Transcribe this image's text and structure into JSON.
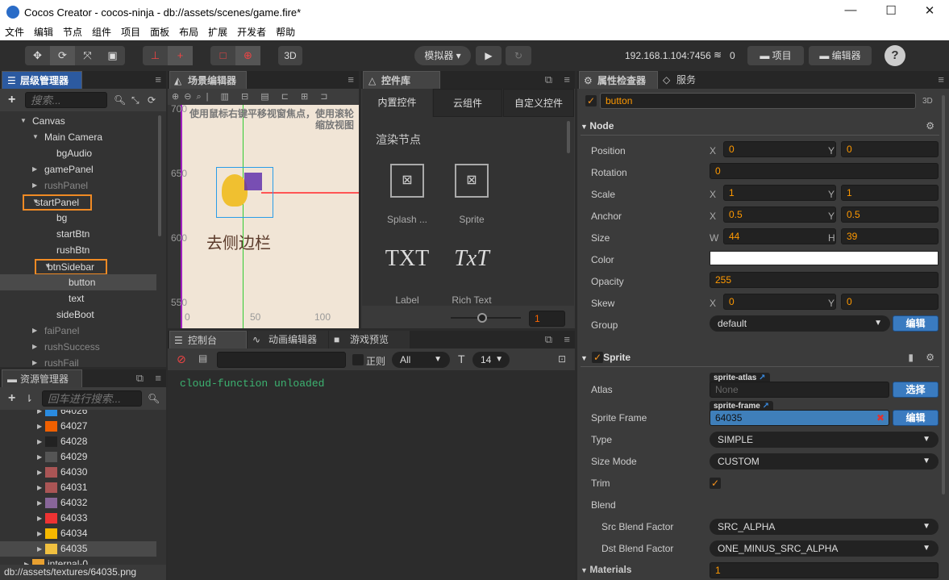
{
  "window": {
    "title": "Cocos Creator - cocos-ninja - db://assets/scenes/game.fire*",
    "minimize": "—",
    "maximize": "☐",
    "close": "✕"
  },
  "menu": [
    "文件",
    "编辑",
    "节点",
    "组件",
    "项目",
    "面板",
    "布局",
    "扩展",
    "开发者",
    "帮助"
  ],
  "toolbar": {
    "mode_3d": "3D",
    "simulator": "模拟器 ▾",
    "play": "▶",
    "refresh": "↻",
    "ip": "192.168.1.104:7456",
    "wifi_count": "0",
    "project_btn": "项目",
    "editor_btn": "编辑器",
    "help": "?"
  },
  "hierarchy": {
    "title": "层级管理器",
    "search_placeholder": "搜索...",
    "items": [
      {
        "label": "Canvas",
        "depth": 0,
        "arrow": "down"
      },
      {
        "label": "Main Camera",
        "depth": 1,
        "arrow": "down"
      },
      {
        "label": "bgAudio",
        "depth": 2,
        "arrow": ""
      },
      {
        "label": "gamePanel",
        "depth": 1,
        "arrow": "right"
      },
      {
        "label": "rushPanel",
        "depth": 1,
        "arrow": "right",
        "dim": true
      },
      {
        "label": "startPanel",
        "depth": 1,
        "arrow": "down",
        "outlined": true
      },
      {
        "label": "bg",
        "depth": 2,
        "arrow": ""
      },
      {
        "label": "startBtn",
        "depth": 2,
        "arrow": ""
      },
      {
        "label": "rushBtn",
        "depth": 2,
        "arrow": ""
      },
      {
        "label": "btnSidebar",
        "depth": 2,
        "arrow": "down",
        "outlined": true
      },
      {
        "label": "button",
        "depth": 3,
        "arrow": "",
        "selected": true
      },
      {
        "label": "text",
        "depth": 3,
        "arrow": ""
      },
      {
        "label": "sideBoot",
        "depth": 2,
        "arrow": ""
      },
      {
        "label": "faiPanel",
        "depth": 1,
        "arrow": "right",
        "dim": true
      },
      {
        "label": "rushSuccess",
        "depth": 1,
        "arrow": "right",
        "dim": true
      },
      {
        "label": "rushFail",
        "depth": 1,
        "arrow": "right",
        "dim": true
      }
    ]
  },
  "assets": {
    "title": "资源管理器",
    "search_placeholder": "回车进行搜索...",
    "items": [
      {
        "label": "64026",
        "color": "#2a8be0"
      },
      {
        "label": "64027",
        "color": "#f06000"
      },
      {
        "label": "64028",
        "color": "#222"
      },
      {
        "label": "64029",
        "color": "#555"
      },
      {
        "label": "64030",
        "color": "#a55"
      },
      {
        "label": "64031",
        "color": "#a55"
      },
      {
        "label": "64032",
        "color": "#869"
      },
      {
        "label": "64033",
        "color": "#e33"
      },
      {
        "label": "64034",
        "color": "#f5b800"
      },
      {
        "label": "64035",
        "color": "#f0c040",
        "selected": true
      },
      {
        "label": "internal-0",
        "color": "#e8a030"
      }
    ],
    "status": "db://assets/textures/64035.png"
  },
  "scene": {
    "title": "场景编辑器",
    "hint": "使用鼠标右键平移视窗焦点，使用滚轮缩放视图",
    "y_ticks": [
      "700",
      "650",
      "600",
      "550"
    ],
    "x_ticks": [
      "0",
      "50",
      "100"
    ],
    "label_text": "去侧边栏"
  },
  "library": {
    "title": "控件库",
    "tabs": [
      "内置控件",
      "云组件",
      "自定义控件"
    ],
    "section": "渲染节点",
    "items": [
      {
        "label": "Splash ...",
        "icon": "image-icon"
      },
      {
        "label": "Sprite",
        "icon": "image-icon"
      },
      {
        "label": "Label",
        "icon": "TXT"
      },
      {
        "label": "Rich Text",
        "icon": "TxT"
      }
    ],
    "zoom_value": "1"
  },
  "console": {
    "tabs": [
      "控制台",
      "动画编辑器",
      "游戏预览"
    ],
    "regex": "正则",
    "level": "All",
    "font_size": "14",
    "log": "cloud-function unloaded"
  },
  "inspector": {
    "tabs": [
      "属性检查器",
      "服务"
    ],
    "node_name": "button",
    "mode": "3D",
    "node_section": "Node",
    "props": [
      {
        "label": "Position",
        "x": "0",
        "y": "0",
        "xl": "X",
        "yl": "Y"
      },
      {
        "label": "Rotation",
        "v": "0"
      },
      {
        "label": "Scale",
        "x": "1",
        "y": "1",
        "xl": "X",
        "yl": "Y"
      },
      {
        "label": "Anchor",
        "x": "0.5",
        "y": "0.5",
        "xl": "X",
        "yl": "Y"
      },
      {
        "label": "Size",
        "x": "44",
        "y": "39",
        "xl": "W",
        "yl": "H"
      },
      {
        "label": "Color",
        "color": "#ffffff"
      },
      {
        "label": "Opacity",
        "v": "255"
      },
      {
        "label": "Skew",
        "x": "0",
        "y": "0",
        "xl": "X",
        "yl": "Y"
      },
      {
        "label": "Group",
        "select": "default",
        "btn": "编辑"
      }
    ],
    "sprite_section": "Sprite",
    "sprite": {
      "atlas_label": "Atlas",
      "atlas_tag": "sprite-atlas",
      "atlas_value": "None",
      "atlas_btn": "选择",
      "frame_label": "Sprite Frame",
      "frame_tag": "sprite-frame",
      "frame_value": "64035",
      "frame_btn": "编辑",
      "type_label": "Type",
      "type_value": "SIMPLE",
      "sizemode_label": "Size Mode",
      "sizemode_value": "CUSTOM",
      "trim_label": "Trim",
      "trim_checked": true,
      "blend_label": "Blend",
      "src_label": "Src Blend Factor",
      "src_value": "SRC_ALPHA",
      "dst_label": "Dst Blend Factor",
      "dst_value": "ONE_MINUS_SRC_ALPHA",
      "materials_label": "Materials",
      "materials_value": "1"
    }
  }
}
